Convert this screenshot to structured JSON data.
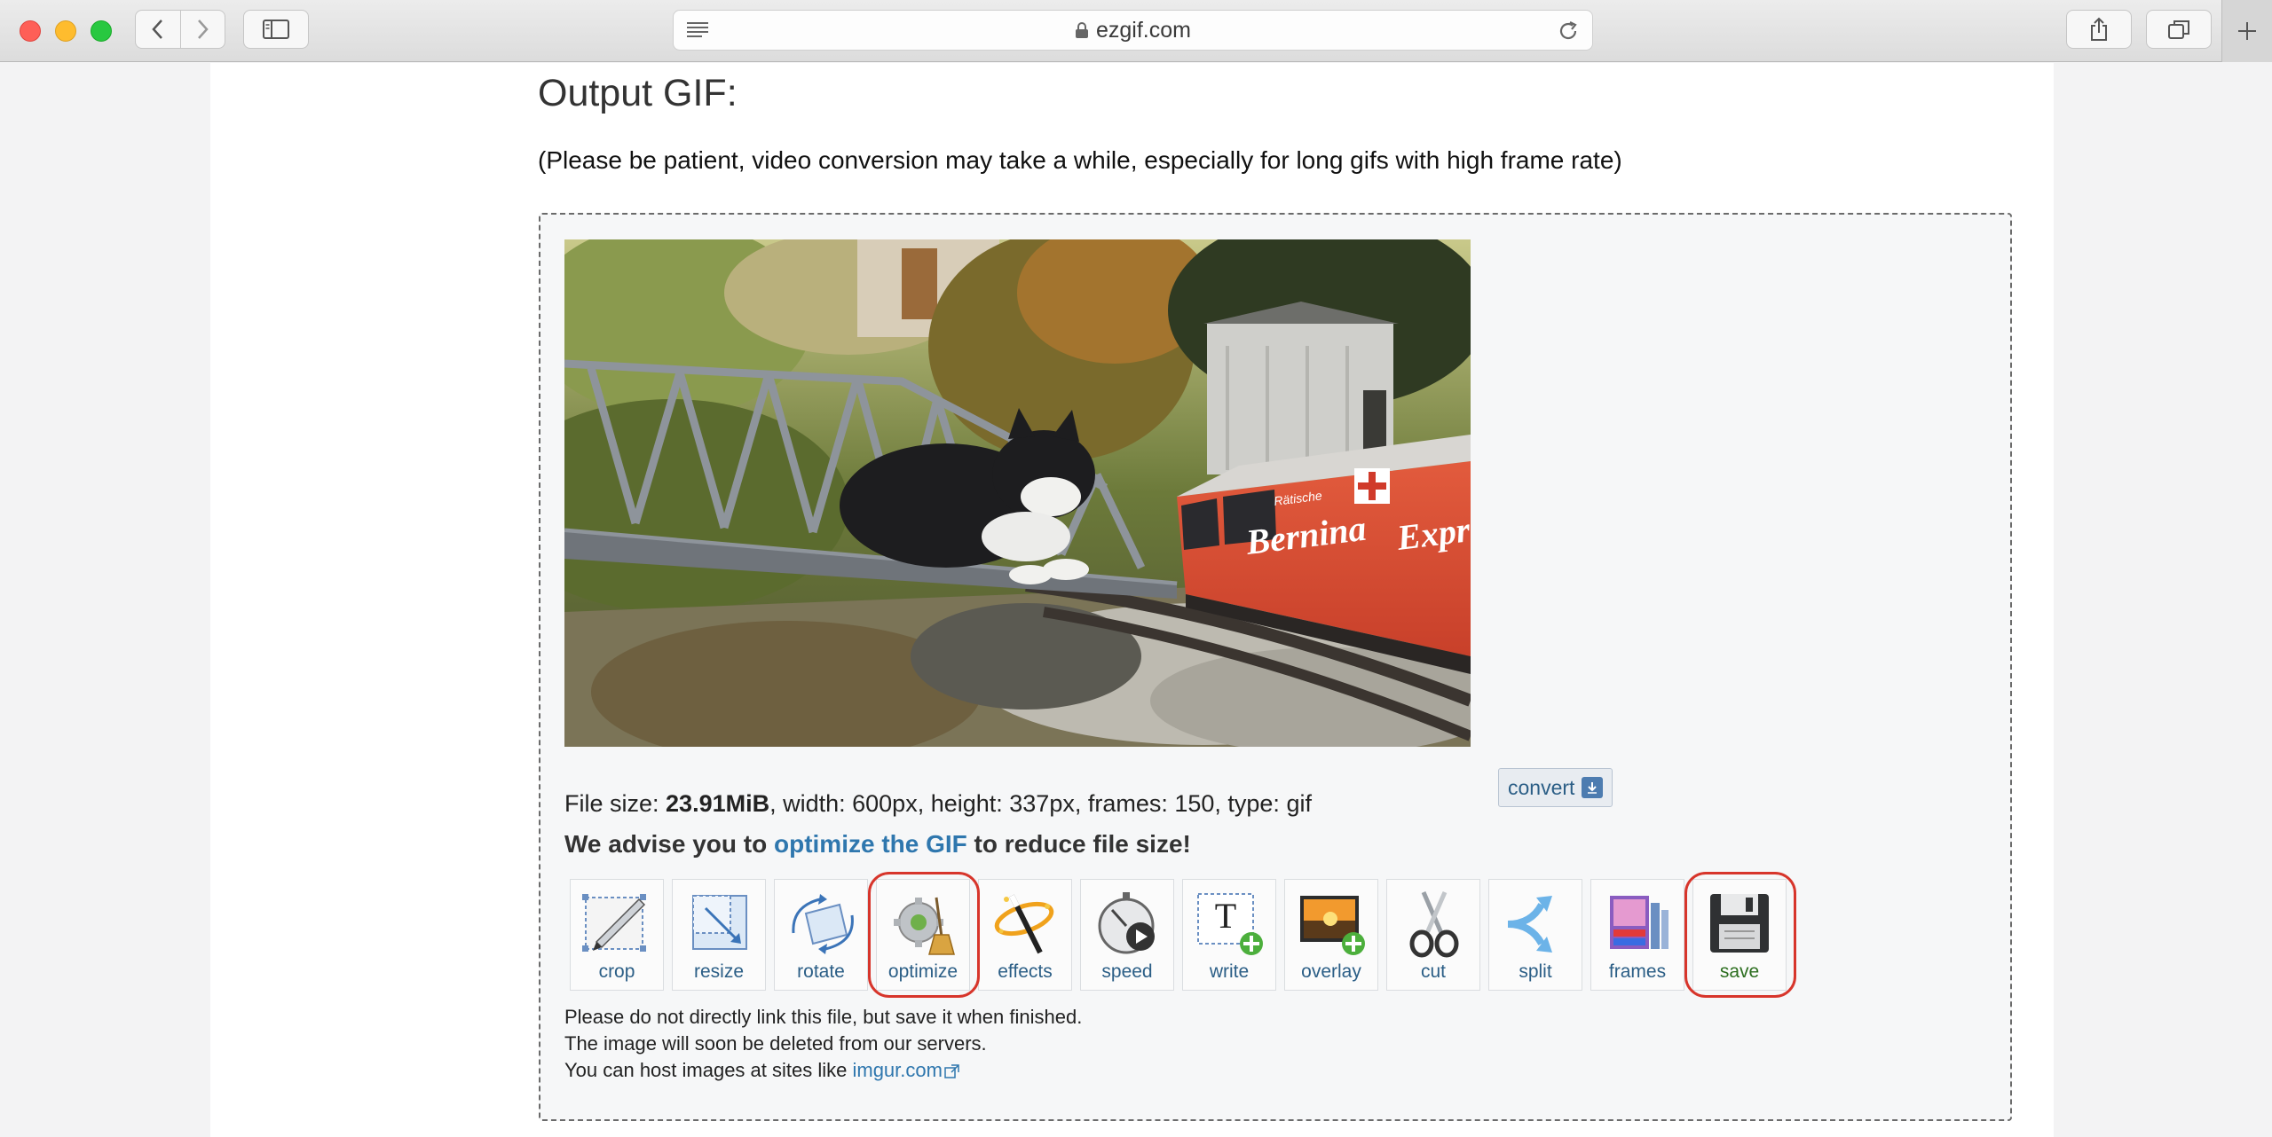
{
  "browser": {
    "url": "ezgif.com"
  },
  "page": {
    "heading": "Output GIF:",
    "patience_note": "(Please be patient, video conversion may take a while, especially for long gifs with high frame rate)"
  },
  "output": {
    "convert_label": "convert",
    "file_info": {
      "prefix": "File size: ",
      "size": "23.91MiB",
      "rest": ", width: 600px, height: 337px, frames: 150, type: gif"
    },
    "advise": {
      "before": "We advise you to ",
      "link": "optimize the GIF",
      "after": " to reduce file size!"
    },
    "gif_text": {
      "brand": "Bernina",
      "brand2": "Expre",
      "small": "Rätische"
    },
    "tools": [
      {
        "label": "crop",
        "icon": "crop-icon"
      },
      {
        "label": "resize",
        "icon": "resize-icon"
      },
      {
        "label": "rotate",
        "icon": "rotate-icon"
      },
      {
        "label": "optimize",
        "icon": "optimize-icon",
        "highlighted": true
      },
      {
        "label": "effects",
        "icon": "effects-icon"
      },
      {
        "label": "speed",
        "icon": "speed-icon"
      },
      {
        "label": "write",
        "icon": "write-icon"
      },
      {
        "label": "overlay",
        "icon": "overlay-icon"
      },
      {
        "label": "cut",
        "icon": "cut-icon"
      },
      {
        "label": "split",
        "icon": "split-icon"
      },
      {
        "label": "frames",
        "icon": "frames-icon"
      },
      {
        "label": "save",
        "icon": "save-icon",
        "highlighted": true
      }
    ],
    "footer": {
      "line1": "Please do not directly link this file, but save it when finished.",
      "line2": "The image will soon be deleted from our servers.",
      "line3_prefix": "You can host images at sites like ",
      "line3_link": "imgur.com"
    }
  },
  "colors": {
    "link": "#2f77ae",
    "highlight_ring": "#d7352b"
  }
}
